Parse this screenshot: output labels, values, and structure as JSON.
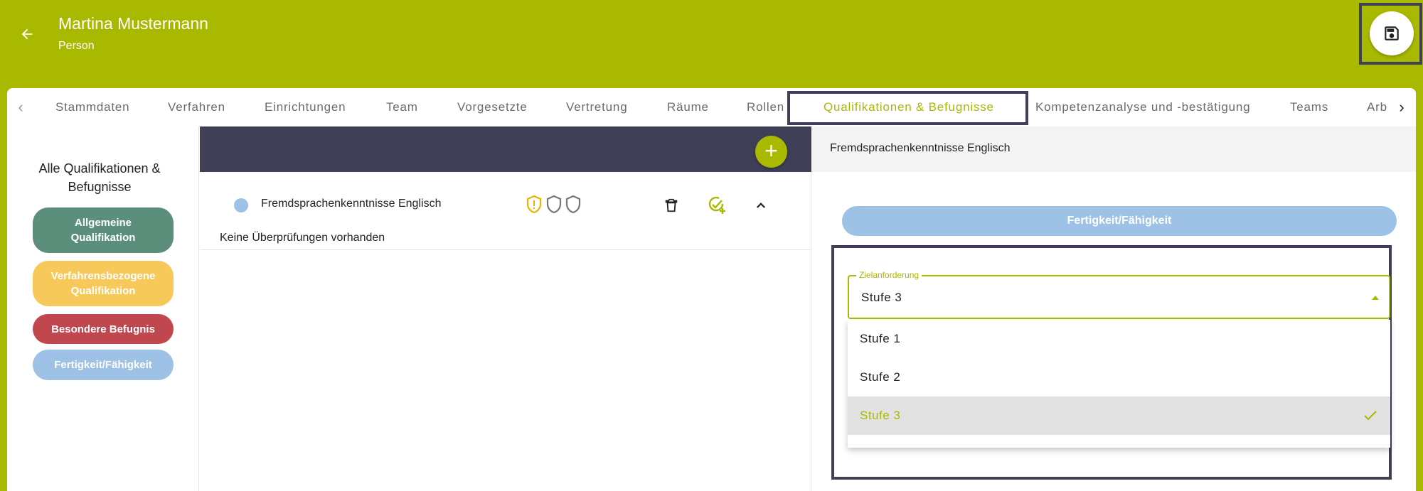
{
  "header": {
    "title": "Martina Mustermann",
    "subtitle": "Person",
    "icons": {
      "back": "arrow-left-icon",
      "save": "save-icon"
    },
    "accent_color": "#a9b900"
  },
  "tabs": [
    {
      "label": "Stammdaten"
    },
    {
      "label": "Verfahren"
    },
    {
      "label": "Einrichtungen"
    },
    {
      "label": "Team"
    },
    {
      "label": "Vorgesetzte"
    },
    {
      "label": "Vertretung"
    },
    {
      "label": "Räume"
    },
    {
      "label": "Rollen"
    },
    {
      "label": "Qualifikationen & Befugnisse",
      "active": true
    },
    {
      "label": "Kompetenzanalyse und -bestätigung"
    },
    {
      "label": "Teams"
    },
    {
      "label": "Arb"
    }
  ],
  "sidebar": {
    "heading": "Alle Qualifikationen & Befugnisse",
    "categories": [
      {
        "label": "Allgemeine Qualifikation",
        "color": "#5c8f7b"
      },
      {
        "label": "Verfahrensbezogene Qualifikation",
        "color": "#f7c95a"
      },
      {
        "label": "Besondere Befugnis",
        "color": "#c0474e"
      },
      {
        "label": "Fertigkeit/Fähigkeit",
        "color": "#9ec2e6"
      }
    ]
  },
  "list": {
    "header_color": "#3f3f58",
    "add_icon": "plus-icon",
    "items": [
      {
        "label": "Fremdsprachenkenntnisse Englisch",
        "dot_color": "#9ec2e6",
        "icons": [
          "shield-alert-icon",
          "shield-icon",
          "shield-icon",
          "trash-icon",
          "check-add-icon",
          "chevron-up-icon"
        ],
        "message": "Keine Überprüfungen vorhanden"
      }
    ]
  },
  "detail": {
    "title": "Fremdsprachenkenntnisse Englisch",
    "category": "Fertigkeit/Fähigkeit",
    "field": {
      "label": "Zielanforderung",
      "value": "Stufe 3",
      "options": [
        "Stufe 1",
        "Stufe 2",
        "Stufe 3"
      ],
      "selected": "Stufe 3"
    }
  }
}
